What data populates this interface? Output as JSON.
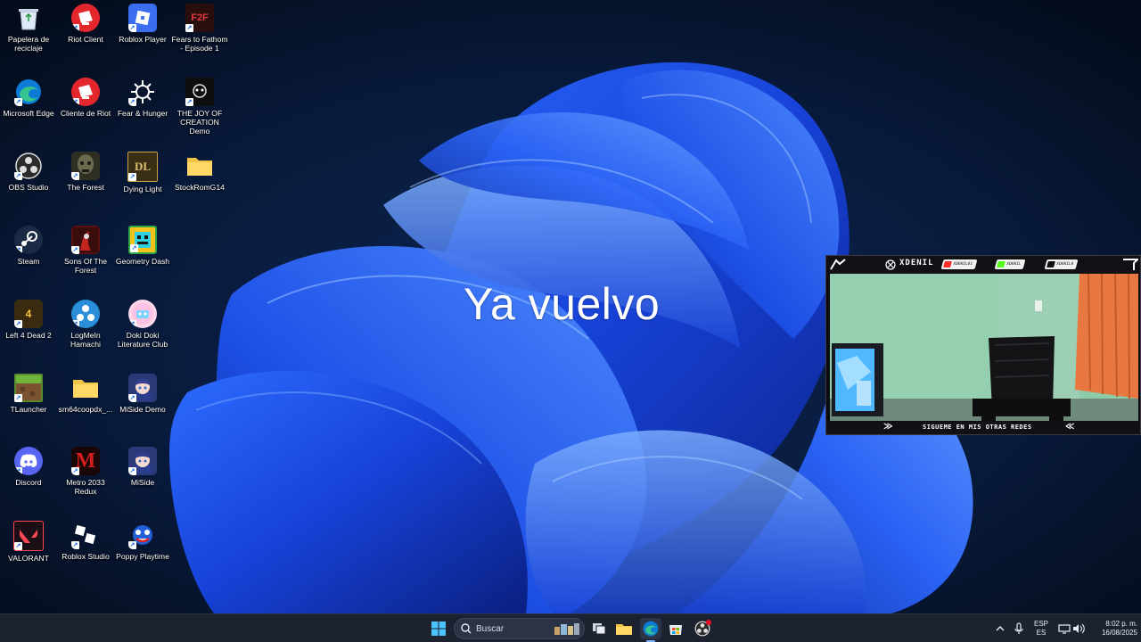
{
  "overlay_text": "Ya vuelvo",
  "desktop_icons": [
    {
      "label": "Papelera de reciclaje",
      "icon": "recycle-bin-icon"
    },
    {
      "label": "Riot Client",
      "icon": "riot-client-icon"
    },
    {
      "label": "Roblox Player",
      "icon": "roblox-player-icon"
    },
    {
      "label": "Fears to Fathom - Episode 1",
      "icon": "fears-to-fathom-icon",
      "glyph": "F2F"
    },
    {
      "label": "Microsoft Edge",
      "icon": "edge-icon"
    },
    {
      "label": "Cliente de Riot",
      "icon": "riot-client-icon"
    },
    {
      "label": "Fear & Hunger",
      "icon": "fear-hunger-icon"
    },
    {
      "label": "THE JOY OF CREATION Demo",
      "icon": "joy-of-creation-icon"
    },
    {
      "label": "OBS Studio",
      "icon": "obs-icon"
    },
    {
      "label": "The Forest",
      "icon": "the-forest-icon"
    },
    {
      "label": "Dying Light",
      "icon": "dying-light-icon",
      "glyph": "DL"
    },
    {
      "label": "StockRomG14",
      "icon": "folder-icon"
    },
    {
      "label": "Steam",
      "icon": "steam-icon"
    },
    {
      "label": "Sons Of The Forest",
      "icon": "sons-of-the-forest-icon"
    },
    {
      "label": "Geometry Dash",
      "icon": "geometry-dash-icon"
    },
    {
      "label": "Left 4 Dead 2",
      "icon": "left4dead2-icon"
    },
    {
      "label": "LogMeIn Hamachi",
      "icon": "hamachi-icon"
    },
    {
      "label": "Doki Doki Literature Club",
      "icon": "ddlc-icon"
    },
    {
      "label": "TLauncher",
      "icon": "tlauncher-icon"
    },
    {
      "label": "sm64coopdx_...",
      "icon": "folder-icon"
    },
    {
      "label": "MiSide Demo",
      "icon": "miside-demo-icon"
    },
    {
      "label": "Discord",
      "icon": "discord-icon"
    },
    {
      "label": "Metro 2033 Redux",
      "icon": "metro-2033-icon",
      "glyph": "M"
    },
    {
      "label": "MiSide",
      "icon": "miside-icon"
    },
    {
      "label": "VALORANT",
      "icon": "valorant-icon"
    },
    {
      "label": "Roblox Studio",
      "icon": "roblox-studio-icon"
    },
    {
      "label": "Poppy Playtime",
      "icon": "poppy-playtime-icon"
    }
  ],
  "webcam": {
    "brand": "XDENIL",
    "socials": [
      {
        "network": "youtube",
        "handle": "XDENIL01",
        "color": "#ff2a2a"
      },
      {
        "network": "kick",
        "handle": "XDENIL",
        "color": "#53fc18"
      },
      {
        "network": "tiktok",
        "handle": "XDENIL0",
        "color": "#111111"
      }
    ],
    "footer": "SIGUEME EN MIS OTRAS REDES"
  },
  "taskbar": {
    "search_placeholder": "Buscar",
    "apps": [
      "windows-start-icon",
      "search-icon",
      "widgets-icon",
      "task-view-icon",
      "file-explorer-icon",
      "edge-icon",
      "microsoft-store-icon",
      "obs-icon"
    ],
    "language_top": "ESP",
    "language_bottom": "ES",
    "time": "8:02 p. m.",
    "date": "16/08/2025"
  },
  "colors": {
    "wallpaper_dark": "#061226",
    "bloom_blue": "#1b4fe0",
    "taskbar": "#1c2230",
    "accent": "#3b82f6"
  }
}
